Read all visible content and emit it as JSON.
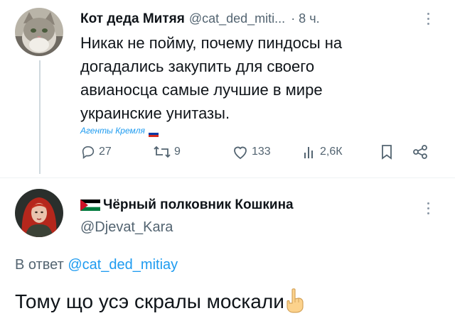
{
  "tweet": {
    "author_name": "Кот деда Митяя",
    "author_handle": "@cat_ded_miti...",
    "time": "· 8 ч.",
    "text_lines": [
      "Никак не пойму, почему пиндосы на",
      "догадались закупить для своего",
      "авианосца самые лучшие в мире",
      "украинские унитазы."
    ],
    "label": "Агенты Кремля",
    "replies": "27",
    "retweets": "9",
    "likes": "133",
    "views": "2,6К"
  },
  "reply": {
    "author_name": "Чёрный полковник Кошкина",
    "author_handle": "@Djevat_Kara",
    "reply_prefix": "В ответ",
    "reply_to": "@cat_ded_mitiay",
    "text": "Тому що усэ скралы москали"
  },
  "icons": {
    "reply": "reply-icon",
    "retweet": "retweet-icon",
    "like": "heart-icon",
    "views": "views-icon",
    "bookmark": "bookmark-icon",
    "share": "share-icon",
    "more": "more-icon",
    "flag_ru": "russia-flag-icon",
    "flag_ps": "palestine-flag-icon",
    "emoji": "pointing-up-emoji"
  },
  "colors": {
    "accent": "#1d9bf0",
    "muted": "#536471",
    "text": "#0f1419"
  }
}
